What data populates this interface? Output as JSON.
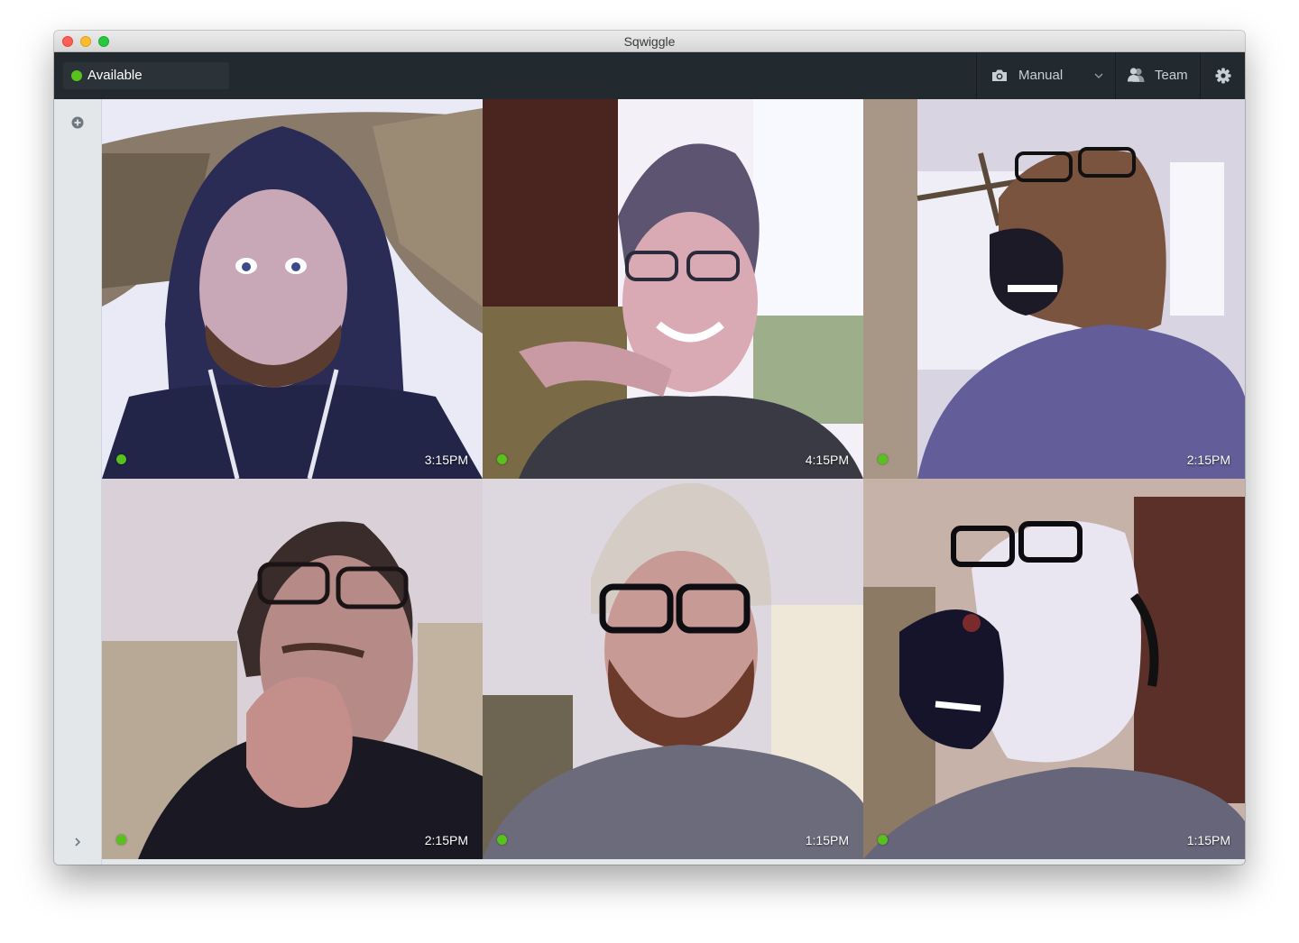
{
  "window": {
    "title": "Sqwiggle"
  },
  "toolbar": {
    "status": {
      "label": "Available",
      "color": "#57c21c",
      "icon": "status-dot-icon"
    },
    "mode": {
      "label": "Manual",
      "icon": "camera-icon",
      "dropdown_icon": "chevron-down-icon"
    },
    "team": {
      "label": "Team",
      "icon": "people-icon"
    },
    "settings": {
      "icon": "gear-icon"
    }
  },
  "sidebar": {
    "add_icon": "add-circle-icon",
    "expand_icon": "chevron-right-icon"
  },
  "tiles": [
    {
      "time": "3:15PM",
      "status": "online"
    },
    {
      "time": "4:15PM",
      "status": "online"
    },
    {
      "time": "2:15PM",
      "status": "online"
    },
    {
      "time": "2:15PM",
      "status": "online"
    },
    {
      "time": "1:15PM",
      "status": "online"
    },
    {
      "time": "1:15PM",
      "status": "online"
    }
  ],
  "colors": {
    "online": "#57c21c",
    "toolbar": "#22292f",
    "sidebar": "#e3e7ea"
  }
}
